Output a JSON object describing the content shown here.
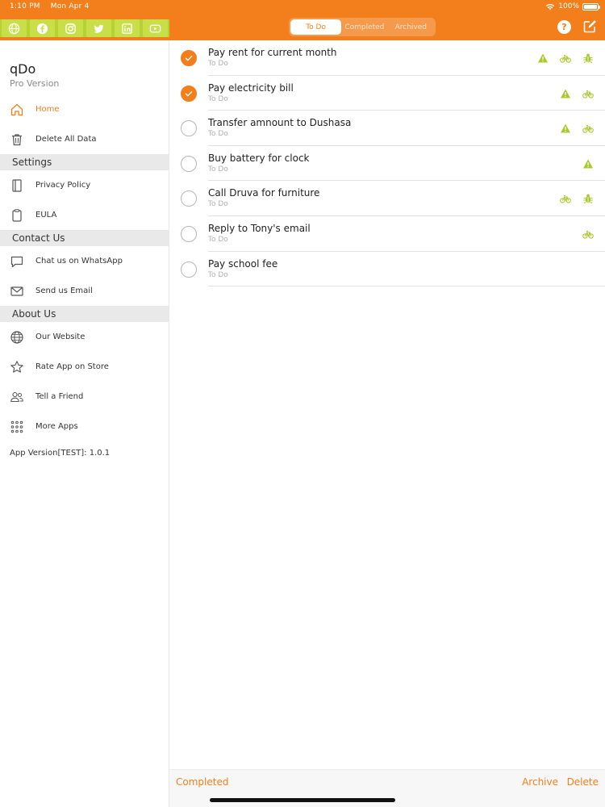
{
  "status": {
    "time": "1:10 PM",
    "date": "Mon Apr 4",
    "battery": "100%"
  },
  "colors": {
    "accent": "#f27f1b",
    "social_green": "#b6d232",
    "tag_green": "#a8c92a"
  },
  "social": [
    {
      "icon": "globe-icon"
    },
    {
      "icon": "facebook-icon"
    },
    {
      "icon": "instagram-icon"
    },
    {
      "icon": "twitter-icon"
    },
    {
      "icon": "linkedin-icon"
    },
    {
      "icon": "youtube-icon"
    }
  ],
  "app": {
    "name": "qDo",
    "subtitle": "Pro Version"
  },
  "menu": {
    "home": "Home",
    "delete_all": "Delete All Data",
    "settings_header": "Settings",
    "privacy": "Privacy Policy",
    "eula": "EULA",
    "contact_header": "Contact Us",
    "whatsapp": "Chat us on WhatsApp",
    "email": "Send us Email",
    "about_header": "About Us",
    "website": "Our Website",
    "rate": "Rate App on Store",
    "tell": "Tell a Friend",
    "more": "More Apps"
  },
  "version": "App Version[TEST]: 1.0.1",
  "tabs": {
    "todo": "To Do",
    "completed": "Completed",
    "archived": "Archived"
  },
  "help_label": "?",
  "tasks": [
    {
      "title": "Pay rent for current month",
      "status": "To Do",
      "done": true,
      "tags": [
        "warning-icon",
        "bicycle-icon",
        "bug-icon"
      ]
    },
    {
      "title": "Pay electricity bill",
      "status": "To Do",
      "done": true,
      "tags": [
        "warning-icon",
        "bicycle-icon"
      ]
    },
    {
      "title": "Transfer amnount to Dushasa",
      "status": "To Do",
      "done": false,
      "tags": [
        "warning-icon",
        "bicycle-icon"
      ]
    },
    {
      "title": "Buy battery for clock",
      "status": "To Do",
      "done": false,
      "tags": [
        "warning-icon"
      ]
    },
    {
      "title": "Call Druva for furniture",
      "status": "To Do",
      "done": false,
      "tags": [
        "bicycle-icon",
        "bug-icon"
      ]
    },
    {
      "title": "Reply to Tony's email",
      "status": "To Do",
      "done": false,
      "tags": [
        "bicycle-icon"
      ]
    },
    {
      "title": "Pay school fee",
      "status": "To Do",
      "done": false,
      "tags": []
    }
  ],
  "bottom": {
    "completed": "Completed",
    "archive": "Archive",
    "delete": "Delete"
  }
}
